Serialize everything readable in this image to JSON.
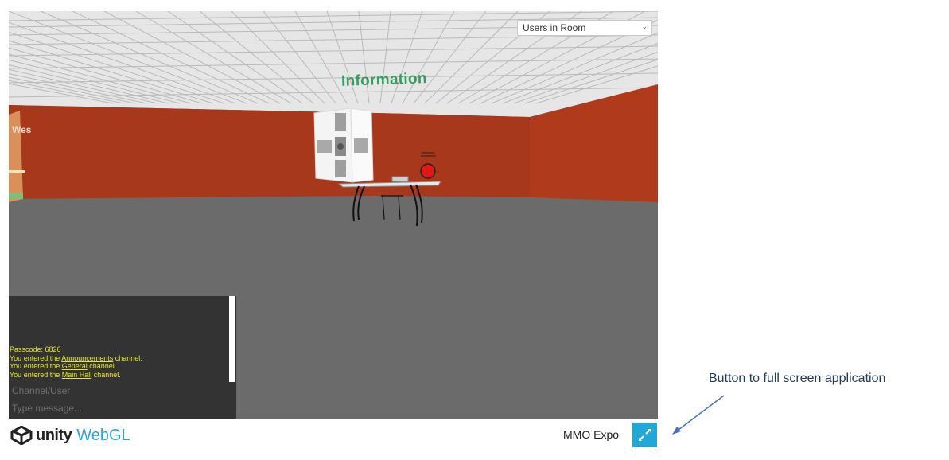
{
  "scene": {
    "sign": "Information",
    "wall_text": "Wes",
    "users_select": {
      "selected": "Users in Room"
    }
  },
  "chat": {
    "lines": [
      {
        "pre": "Passcode: 6826",
        "link": "",
        "post": ""
      },
      {
        "pre": "You entered the ",
        "link": "Announcements",
        "post": " channel."
      },
      {
        "pre": "You entered the ",
        "link": "General",
        "post": " channel."
      },
      {
        "pre": "You entered the ",
        "link": "Main Hall",
        "post": " channel."
      }
    ],
    "channel_placeholder": "Channel/User",
    "message_placeholder": "Type message..."
  },
  "footer": {
    "brand_unity": "unity",
    "brand_webgl": "WebGL",
    "app_title": "MMO Expo",
    "fullscreen_icon": "expand-icon"
  },
  "annotation": "Button to full screen application",
  "colors": {
    "wall": "#a8381c",
    "floor": "#6b6b6b",
    "ceiling": "#e6e6e6",
    "sign": "#3a9a63",
    "chat_bg": "#333333",
    "chat_text": "#e8e81e",
    "fullscreen_button": "#23a7d7",
    "webgl_brand": "#2aa6d9"
  }
}
